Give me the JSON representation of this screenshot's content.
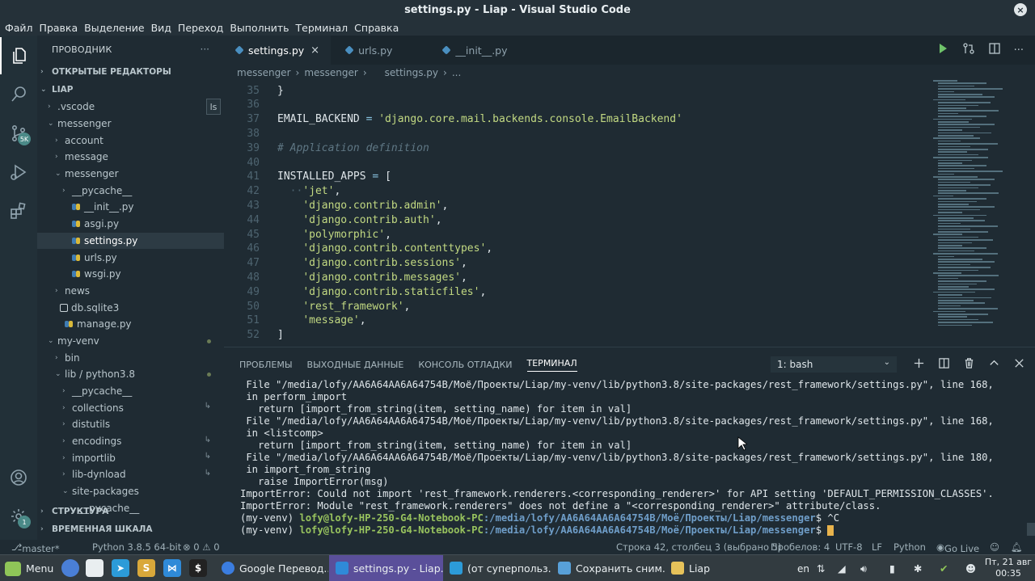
{
  "window": {
    "title": "settings.py - Liap - Visual Studio Code",
    "close_icon": "×"
  },
  "menu": [
    "Файл",
    "Правка",
    "Выделение",
    "Вид",
    "Переход",
    "Выполнить",
    "Терминал",
    "Справка"
  ],
  "activity": {
    "scm_badge": "5K",
    "settings_badge": "1"
  },
  "sidebar": {
    "header": "ПРОВОДНИК",
    "more": "···",
    "open_editors": "ОТКРЫТЫЕ РЕДАКТОРЫ",
    "root": "LIAP",
    "tooltip": "ls",
    "tree": [
      {
        "label": ".vscode",
        "chev": "›",
        "indent": 1
      },
      {
        "label": "messenger",
        "chev": "⌄",
        "indent": 1
      },
      {
        "label": "account",
        "chev": "›",
        "indent": 2
      },
      {
        "label": "message",
        "chev": "›",
        "indent": 2
      },
      {
        "label": "messenger",
        "chev": "⌄",
        "indent": 2
      },
      {
        "label": "__pycache__",
        "chev": "›",
        "indent": 3
      },
      {
        "label": "__init__.py",
        "py": true,
        "indent": 3
      },
      {
        "label": "asgi.py",
        "py": true,
        "indent": 3
      },
      {
        "label": "settings.py",
        "py": true,
        "indent": 3,
        "selected": true
      },
      {
        "label": "urls.py",
        "py": true,
        "indent": 3
      },
      {
        "label": "wsgi.py",
        "py": true,
        "indent": 3
      },
      {
        "label": "news",
        "chev": "›",
        "indent": 2
      },
      {
        "label": "db.sqlite3",
        "db": true,
        "indent": 2
      },
      {
        "label": "manage.py",
        "py": true,
        "indent": 2
      },
      {
        "label": "my-venv",
        "chev": "⌄",
        "indent": 1,
        "dot": true
      },
      {
        "label": "bin",
        "chev": "›",
        "indent": 2
      },
      {
        "label": "lib / python3.8",
        "chev": "⌄",
        "indent": 2,
        "dot": true
      },
      {
        "label": "__pycache__",
        "chev": "›",
        "indent": 3
      },
      {
        "label": "collections",
        "chev": "›",
        "indent": 3,
        "link": true
      },
      {
        "label": "distutils",
        "chev": "›",
        "indent": 3
      },
      {
        "label": "encodings",
        "chev": "›",
        "indent": 3,
        "link": true
      },
      {
        "label": "importlib",
        "chev": "›",
        "indent": 3,
        "link": true
      },
      {
        "label": "lib-dynload",
        "chev": "›",
        "indent": 3,
        "link": true
      },
      {
        "label": "site-packages",
        "chev": "⌄",
        "indent": 3
      },
      {
        "label": "__pycache__",
        "chev": "›",
        "indent": 4
      }
    ],
    "outline": "СТРУКТУРА",
    "timeline": "ВРЕМЕННАЯ ШКАЛА"
  },
  "tabs": [
    {
      "label": "settings.py",
      "active": true,
      "close": "×"
    },
    {
      "label": "urls.py",
      "active": false
    },
    {
      "label": "__init__.py",
      "active": false
    }
  ],
  "breadcrumb": [
    "messenger",
    "›",
    "messenger",
    "›",
    "settings.py",
    "›",
    "..."
  ],
  "editor": {
    "lines": [
      {
        "n": "35",
        "segs": [
          [
            "}",
            "c-plain"
          ]
        ]
      },
      {
        "n": "36",
        "segs": []
      },
      {
        "n": "37",
        "segs": [
          [
            "EMAIL_BACKEND ",
            "c-plain"
          ],
          [
            "= ",
            "c-op"
          ],
          [
            "'django.core.mail.backends.console.EmailBackend'",
            "c-str"
          ]
        ]
      },
      {
        "n": "38",
        "segs": []
      },
      {
        "n": "39",
        "segs": [
          [
            "# Application definition",
            "c-com"
          ]
        ]
      },
      {
        "n": "40",
        "segs": []
      },
      {
        "n": "41",
        "segs": [
          [
            "INSTALLED_APPS ",
            "c-plain"
          ],
          [
            "= ",
            "c-op"
          ],
          [
            "[",
            "c-plain"
          ]
        ]
      },
      {
        "n": "42",
        "segs": [
          [
            "  ··",
            "c-guide"
          ],
          [
            "'jet'",
            "c-str"
          ],
          [
            ",",
            "c-plain"
          ]
        ]
      },
      {
        "n": "43",
        "segs": [
          [
            "    ",
            "c-plain"
          ],
          [
            "'django.contrib.admin'",
            "c-str"
          ],
          [
            ",",
            "c-plain"
          ]
        ]
      },
      {
        "n": "44",
        "segs": [
          [
            "    ",
            "c-plain"
          ],
          [
            "'django.contrib.auth'",
            "c-str"
          ],
          [
            ",",
            "c-plain"
          ]
        ]
      },
      {
        "n": "45",
        "segs": [
          [
            "    ",
            "c-plain"
          ],
          [
            "'polymorphic'",
            "c-str"
          ],
          [
            ",",
            "c-plain"
          ]
        ]
      },
      {
        "n": "46",
        "segs": [
          [
            "    ",
            "c-plain"
          ],
          [
            "'django.contrib.contenttypes'",
            "c-str"
          ],
          [
            ",",
            "c-plain"
          ]
        ]
      },
      {
        "n": "47",
        "segs": [
          [
            "    ",
            "c-plain"
          ],
          [
            "'django.contrib.sessions'",
            "c-str"
          ],
          [
            ",",
            "c-plain"
          ]
        ]
      },
      {
        "n": "48",
        "segs": [
          [
            "    ",
            "c-plain"
          ],
          [
            "'django.contrib.messages'",
            "c-str"
          ],
          [
            ",",
            "c-plain"
          ]
        ]
      },
      {
        "n": "49",
        "segs": [
          [
            "    ",
            "c-plain"
          ],
          [
            "'django.contrib.staticfiles'",
            "c-str"
          ],
          [
            ",",
            "c-plain"
          ]
        ]
      },
      {
        "n": "50",
        "segs": [
          [
            "    ",
            "c-plain"
          ],
          [
            "'rest_framework'",
            "c-str"
          ],
          [
            ",",
            "c-plain"
          ]
        ]
      },
      {
        "n": "51",
        "segs": [
          [
            "    ",
            "c-plain"
          ],
          [
            "'message'",
            "c-str"
          ],
          [
            ",",
            "c-plain"
          ]
        ]
      },
      {
        "n": "52",
        "segs": [
          [
            "]",
            "c-plain"
          ]
        ]
      }
    ]
  },
  "panel": {
    "tabs": [
      "ПРОБЛЕМЫ",
      "ВЫХОДНЫЕ ДАННЫЕ",
      "КОНСОЛЬ ОТЛАДКИ",
      "ТЕРМИНАЛ"
    ],
    "active_tab": 3,
    "terminal_select": "1: bash",
    "terminal": [
      " File \"/media/lofy/AA6A64AA6A64754B/Моё/Проекты/Liap/my-venv/lib/python3.8/site-packages/rest_framework/settings.py\", line 168,",
      " in perform_import",
      "   return [import_from_string(item, setting_name) for item in val]",
      " File \"/media/lofy/AA6A64AA6A64754B/Моё/Проекты/Liap/my-venv/lib/python3.8/site-packages/rest_framework/settings.py\", line 168,",
      " in <listcomp>",
      "   return [import_from_string(item, setting_name) for item in val]",
      " File \"/media/lofy/AA6A64AA6A64754B/Моё/Проекты/Liap/my-venv/lib/python3.8/site-packages/rest_framework/settings.py\", line 180,",
      " in import_from_string",
      "   raise ImportError(msg)",
      "ImportError: Could not import 'rest_framework.renderers.<corresponding_renderer>' for API setting 'DEFAULT_PERMISSION_CLASSES'.",
      "ImportError: Module \"rest_framework.renderers\" does not define a \"<corresponding_renderer>\" attribute/class."
    ],
    "prompts": [
      {
        "env": "(my-venv) ",
        "user": "lofy@lofy-HP-250-G4-Notebook-PC",
        "path": ":/media/lofy/AA6A64AA6A64754B/Моё/Проекты/Liap/messenger",
        "tail": "$ ^C"
      },
      {
        "env": "(my-venv) ",
        "user": "lofy@lofy-HP-250-G4-Notebook-PC",
        "path": ":/media/lofy/AA6A64AA6A64754B/Моё/Проекты/Liap/messenger",
        "tail": "$ "
      }
    ]
  },
  "status": {
    "branch": "master*",
    "python": "Python 3.8.5 64-bit",
    "problems": "⊗ 0 ⚠ 0",
    "position": "Строка 42, столбец 3 (выбрано 5)",
    "spaces": "Пробелов: 4",
    "encoding": "UTF-8",
    "eol": "LF",
    "language": "Python",
    "golive": "Go Live"
  },
  "taskbar": {
    "menu": "Menu",
    "windows": [
      {
        "label": "Google Перевод...",
        "active": false,
        "color": "#3b7de0"
      },
      {
        "label": "settings.py - Liap...",
        "active": true,
        "color": "#2f8ad8"
      },
      {
        "label": "(от суперпольз...",
        "active": false,
        "color": "#2c9bd8"
      },
      {
        "label": "Сохранить сним...",
        "active": false,
        "color": "#58a0d8"
      },
      {
        "label": "Liap",
        "active": false,
        "color": "#e6c25a"
      }
    ],
    "lang": "en",
    "date": "Пт, 21 авг",
    "time": "00:35"
  }
}
